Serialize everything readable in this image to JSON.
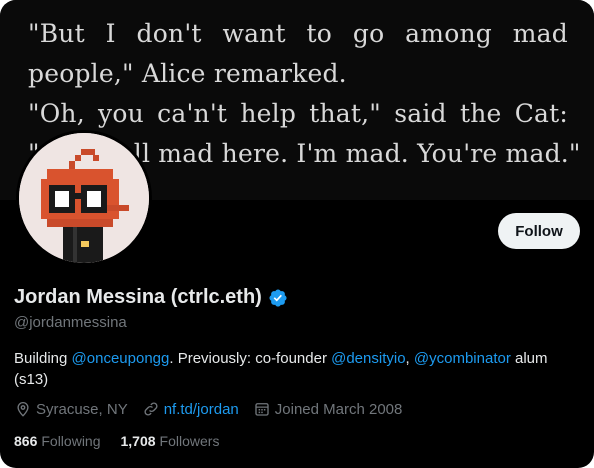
{
  "banner": {
    "quote_lines": [
      "\"But I don't want to go among mad",
      "people,\" Alice remarked.",
      "\"Oh, you ca'n't help that,\" said the Cat:",
      "\"we're all mad here. I'm mad. You're mad.\""
    ]
  },
  "profile": {
    "follow_label": "Follow",
    "name": "Jordan Messina (ctrlc.eth)",
    "verified_icon": "verified-badge-icon",
    "handle": "@jordanmessina",
    "bio": {
      "t1": "Building ",
      "m1": "@onceupongg",
      "t2": ". Previously: co-founder ",
      "m2": "@densityio",
      "t3": ", ",
      "m3": "@ycombinator",
      "t4": " alum (s13)"
    },
    "location": "Syracuse, NY",
    "website": "nf.td/jordan",
    "joined": "Joined March 2008",
    "following_count": "866",
    "following_label": "Following",
    "followers_count": "1,708",
    "followers_label": "Followers"
  },
  "colors": {
    "accent": "#1d9bf0",
    "muted": "#71767b",
    "text": "#e7e9ea",
    "background": "#000000"
  }
}
